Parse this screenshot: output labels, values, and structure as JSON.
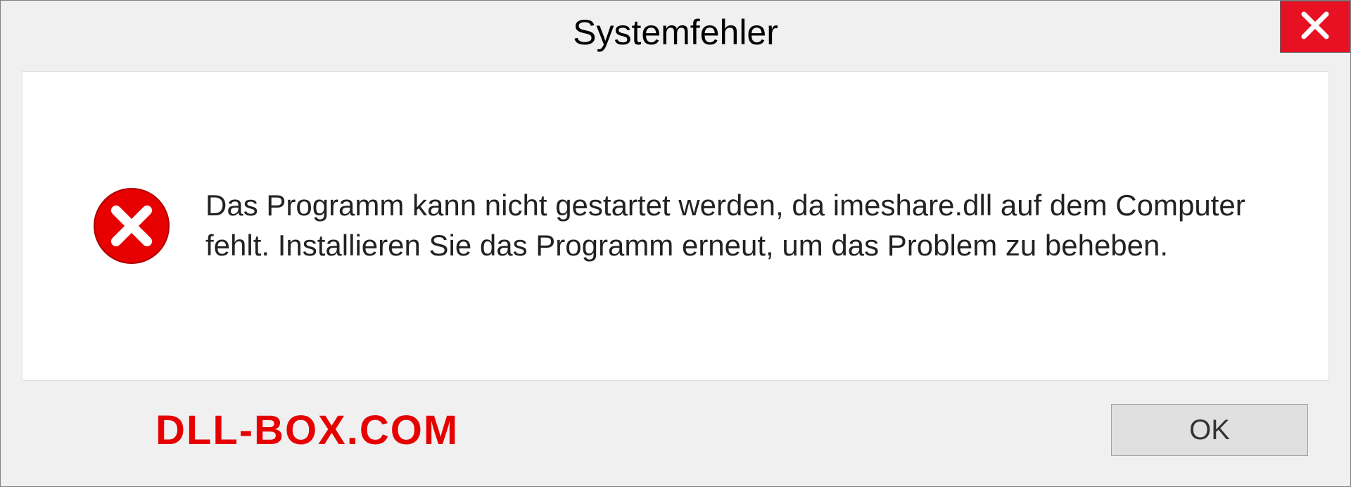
{
  "dialog": {
    "title": "Systemfehler",
    "message": "Das Programm kann nicht gestartet werden, da imeshare.dll auf dem Computer fehlt. Installieren Sie das Programm erneut, um das Problem zu beheben.",
    "ok_label": "OK"
  },
  "watermark": "DLL-BOX.COM"
}
